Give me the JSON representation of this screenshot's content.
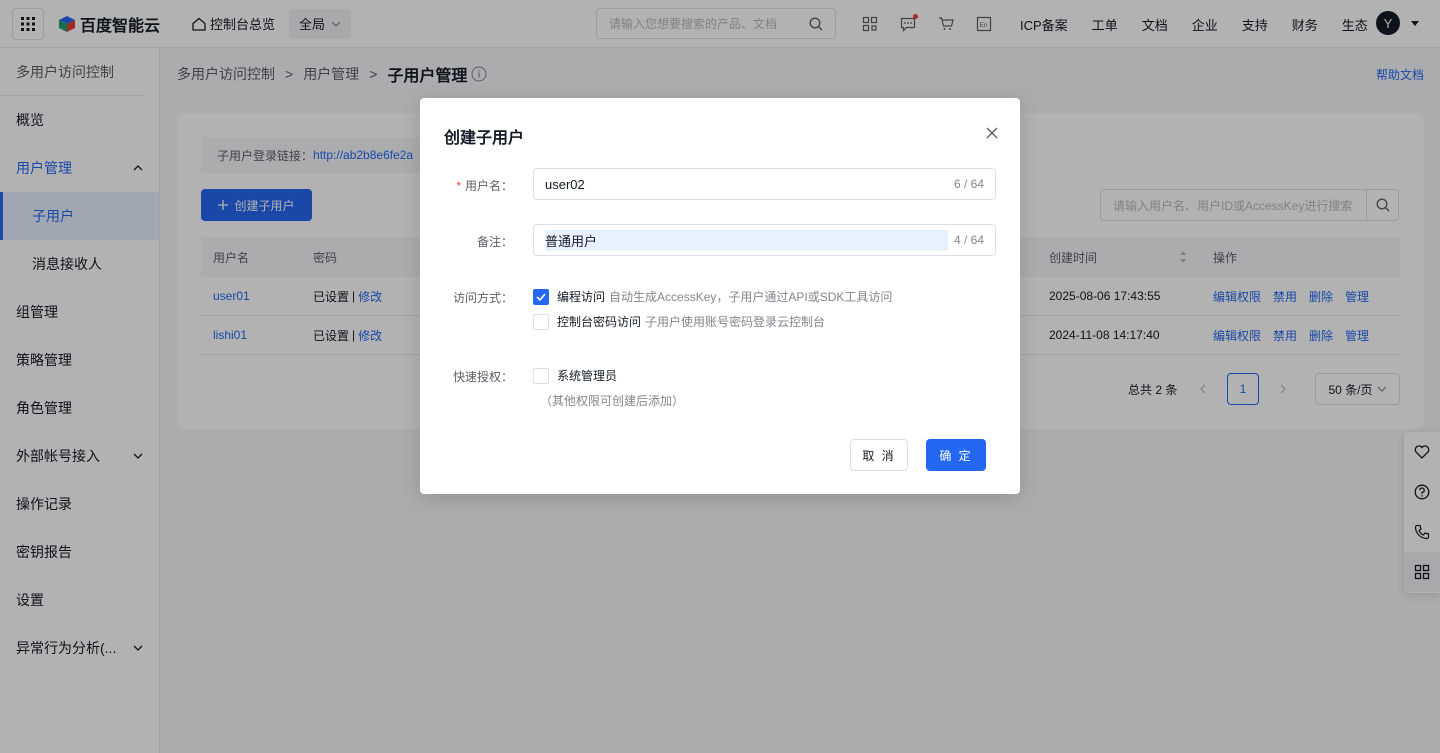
{
  "topbar": {
    "brand": "百度智能云",
    "home": "控制台总览",
    "region": "全局",
    "search_placeholder": "请输入您想要搜索的产品、文档",
    "links": [
      "ICP备案",
      "工单",
      "文档",
      "企业",
      "支持",
      "财务",
      "生态"
    ],
    "avatar": "Y",
    "icons": [
      "qrcode-icon",
      "message-icon",
      "cart-icon",
      "language-en-icon"
    ]
  },
  "sidebar": {
    "title": "多用户访问控制",
    "items": [
      {
        "label": "概览"
      },
      {
        "label": "用户管理",
        "expanded": true
      },
      {
        "label": "子用户",
        "active": true
      },
      {
        "label": "消息接收人"
      },
      {
        "label": "组管理"
      },
      {
        "label": "策略管理"
      },
      {
        "label": "角色管理"
      },
      {
        "label": "外部帐号接入"
      },
      {
        "label": "操作记录"
      },
      {
        "label": "密钥报告"
      },
      {
        "label": "设置"
      },
      {
        "label": "异常行为分析(..."
      }
    ]
  },
  "breadcrumb": {
    "items": [
      "多用户访问控制",
      "用户管理",
      "子用户管理"
    ],
    "help": "帮助文档"
  },
  "page": {
    "login_link_label": "子用户登录链接：",
    "login_link_url": "http://ab2b8e6fe2a",
    "create_button": "创建子用户",
    "search_placeholder": "请输入用户名、用户ID或AccessKey进行搜索",
    "table": {
      "headers": {
        "username": "用户名",
        "password": "密码",
        "created": "创建时间",
        "actions": "操作"
      },
      "rows": [
        {
          "username": "user01",
          "password": "已设置",
          "edit": "修改",
          "created": "2025-08-06 17:43:55"
        },
        {
          "username": "lishi01",
          "password": "已设置",
          "edit": "修改",
          "created": "2024-11-08 14:17:40"
        }
      ],
      "row_separator": "|",
      "actions": [
        "编辑权限",
        "禁用",
        "删除",
        "管理"
      ]
    },
    "pagination": {
      "total": "总共 2 条",
      "current_page": "1",
      "page_size": "50 条/页"
    }
  },
  "modal": {
    "title": "创建子用户",
    "required_mark": "*",
    "username_label": "用户名：",
    "username_value": "user02",
    "username_count": "6 / 64",
    "remark_label": "备注：",
    "remark_value": "普通用户",
    "remark_count": "4 / 64",
    "access_label": "访问方式：",
    "access_options": [
      {
        "label": "编程访问",
        "desc": "自动生成AccessKey，子用户通过API或SDK工具访问",
        "checked": true
      },
      {
        "label": "控制台密码访问",
        "desc": "子用户使用账号密码登录云控制台",
        "checked": false
      }
    ],
    "quick_auth_label": "快速授权：",
    "quick_auth_option": "系统管理员",
    "quick_auth_checked": false,
    "quick_auth_hint": "（其他权限可创建后添加）",
    "cancel": "取 消",
    "confirm": "确 定"
  },
  "float_tools": [
    "heart-icon",
    "help-icon",
    "phone-icon",
    "apps-icon"
  ],
  "colors": {
    "primary": "#2468f2",
    "overlay": "rgba(0,0,0,0.3)",
    "danger": "#f33e3e"
  }
}
